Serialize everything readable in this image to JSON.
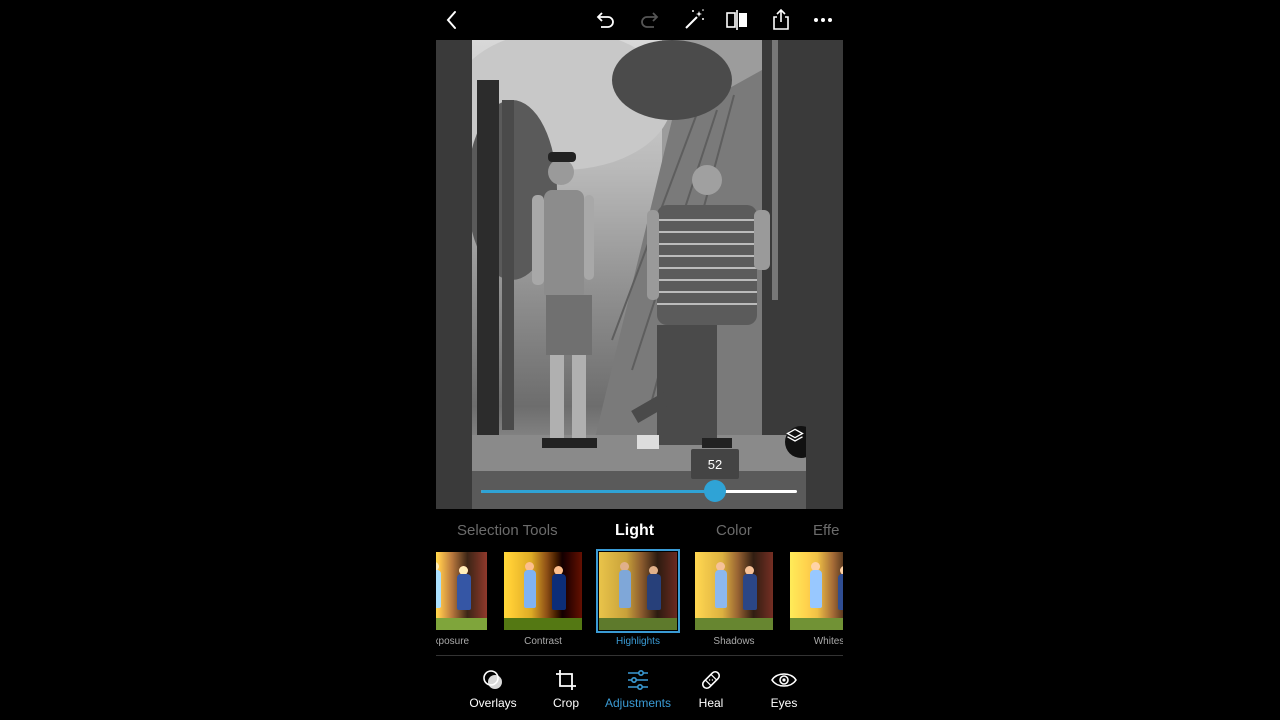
{
  "toolbar": {
    "back": "back-icon",
    "undo": "undo-icon",
    "redo": "redo-icon",
    "auto_fix": "magic-wand-icon",
    "compare": "compare-icon",
    "share": "share-icon",
    "more": "more-icon"
  },
  "slider": {
    "value": "52",
    "fraction": 0.74,
    "accent": "#2fa3d6"
  },
  "category_tabs": [
    {
      "label": "Selection Tools",
      "active": false
    },
    {
      "label": "Light",
      "active": true
    },
    {
      "label": "Color",
      "active": false
    },
    {
      "label": "Effe",
      "active": false
    }
  ],
  "adjustments": [
    {
      "label": "Exposure",
      "active": false
    },
    {
      "label": "Contrast",
      "active": false
    },
    {
      "label": "Highlights",
      "active": true
    },
    {
      "label": "Shadows",
      "active": false
    },
    {
      "label": "Whites",
      "active": false
    }
  ],
  "bottom_nav": [
    {
      "label": "Overlays",
      "icon": "overlays-icon",
      "active": false
    },
    {
      "label": "Crop",
      "icon": "crop-icon",
      "active": false
    },
    {
      "label": "Adjustments",
      "icon": "sliders-icon",
      "active": true
    },
    {
      "label": "Heal",
      "icon": "bandage-icon",
      "active": false
    },
    {
      "label": "Eyes",
      "icon": "eye-icon",
      "active": false
    }
  ],
  "colors": {
    "accent": "#3a9bd5",
    "background": "#000000"
  }
}
